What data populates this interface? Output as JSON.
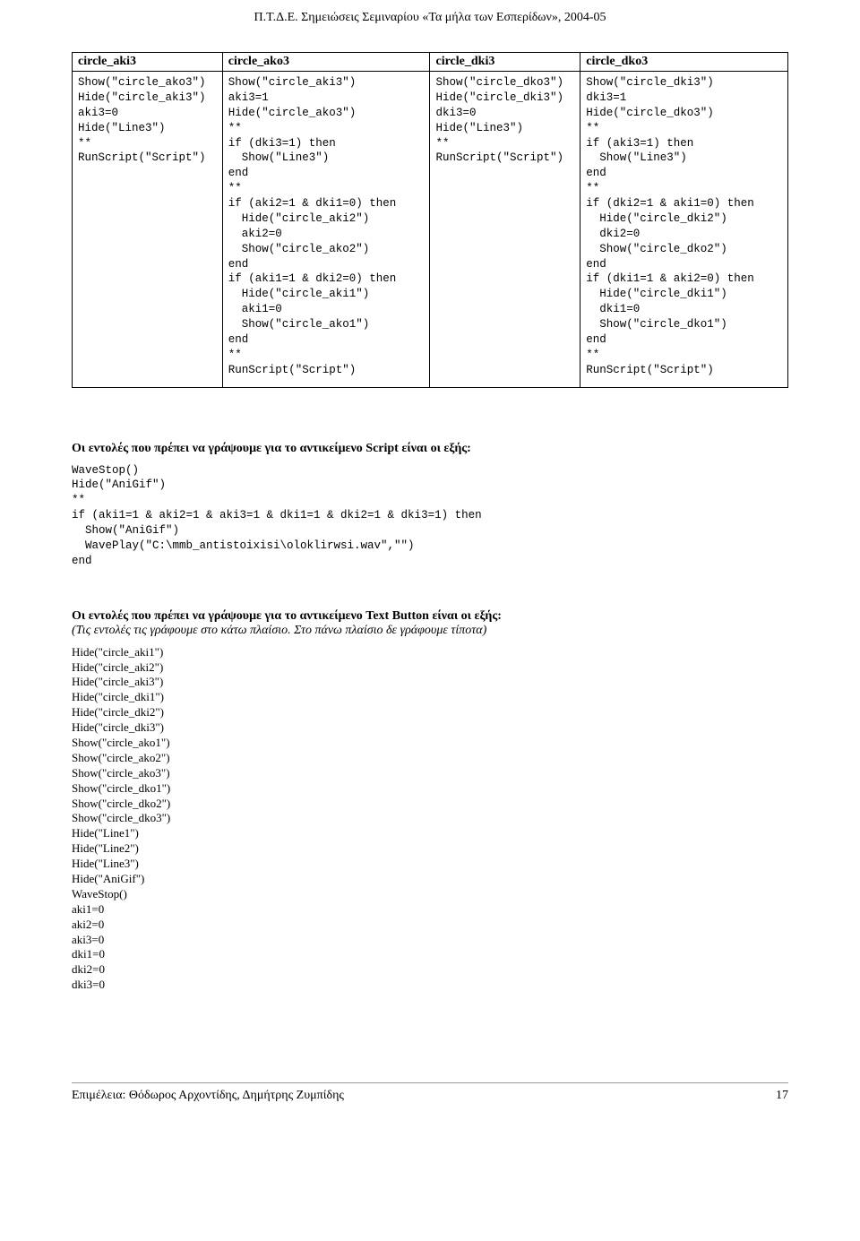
{
  "header": "Π.Τ.Δ.Ε.  Σημειώσεις Σεμιναρίου «Τα μήλα των Εσπερίδων»,  2004-05",
  "table": {
    "cols": [
      "circle_aki3",
      "circle_ako3",
      "circle_dki3",
      "circle_dko3"
    ],
    "cells": [
      "Show(\"circle_ako3\")\nHide(\"circle_aki3\")\naki3=0\nHide(\"Line3\")\n**\nRunScript(\"Script\")",
      "Show(\"circle_aki3\")\naki3=1\nHide(\"circle_ako3\")\n**\nif (dki3=1) then\n  Show(\"Line3\")\nend\n**\nif (aki2=1 & dki1=0) then\n  Hide(\"circle_aki2\")\n  aki2=0\n  Show(\"circle_ako2\")\nend\nif (aki1=1 & dki2=0) then\n  Hide(\"circle_aki1\")\n  aki1=0\n  Show(\"circle_ako1\")\nend\n**\nRunScript(\"Script\")",
      "Show(\"circle_dko3\")\nHide(\"circle_dki3\")\ndki3=0\nHide(\"Line3\")\n**\nRunScript(\"Script\")",
      "Show(\"circle_dki3\")\ndki3=1\nHide(\"circle_dko3\")\n**\nif (aki3=1) then\n  Show(\"Line3\")\nend\n**\nif (dki2=1 & aki1=0) then\n  Hide(\"circle_dki2\")\n  dki2=0\n  Show(\"circle_dko2\")\nend\nif (dki1=1 & aki2=0) then\n  Hide(\"circle_dki1\")\n  dki1=0\n  Show(\"circle_dko1\")\nend\n**\nRunScript(\"Script\")"
    ]
  },
  "section1": {
    "heading": "Οι  εντολές που πρέπει να γράψουμε για το αντικείμενο Script είναι οι εξής:",
    "code": "WaveStop()\nHide(\"AniGif\")\n**\nif (aki1=1 & aki2=1 & aki3=1 & dki1=1 & dki2=1 & dki3=1) then\n  Show(\"AniGif\")\n  WavePlay(\"C:\\mmb_antistoixisi\\oloklirwsi.wav\",\"\")\nend"
  },
  "section2": {
    "heading": "Οι  εντολές που πρέπει να γράψουμε για το αντικείμενο Text Button είναι οι εξής:",
    "note": "(Τις εντολές τις γράφουμε στο κάτω πλαίσιο. Στο πάνω πλαίσιο δε γράφουμε τίποτα)",
    "list": "Hide(\"circle_aki1\")\nHide(\"circle_aki2\")\nHide(\"circle_aki3\")\nHide(\"circle_dki1\")\nHide(\"circle_dki2\")\nHide(\"circle_dki3\")\nShow(\"circle_ako1\")\nShow(\"circle_ako2\")\nShow(\"circle_ako3\")\nShow(\"circle_dko1\")\nShow(\"circle_dko2\")\nShow(\"circle_dko3\")\nHide(\"Line1\")\nHide(\"Line2\")\nHide(\"Line3\")\nHide(\"AniGif\")\nWaveStop()\naki1=0\naki2=0\naki3=0\ndki1=0\ndki2=0\ndki3=0"
  },
  "footer": {
    "left": "Επιμέλεια: Θόδωρος Αρχοντίδης, Δημήτρης Ζυμπίδης",
    "right": "17"
  }
}
